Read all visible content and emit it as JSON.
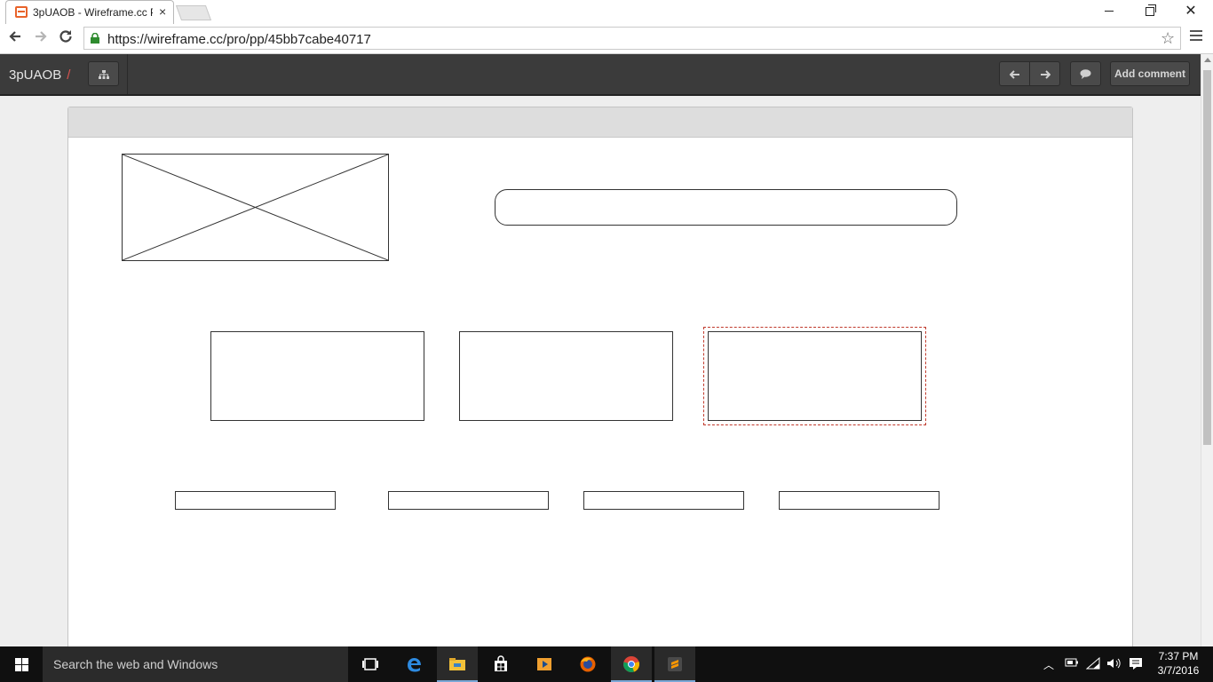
{
  "browser": {
    "tab_title": "3pUAOB - Wireframe.cc P",
    "tab_close": "×",
    "url": "https://wireframe.cc/pro/pp/45bb7cabe40717",
    "win_close": "✕"
  },
  "app_header": {
    "project_name": "3pUAOB",
    "project_separator": "/",
    "add_comment_label": "Add comment"
  },
  "taskbar": {
    "search_placeholder": "Search the web and Windows",
    "time": "7:37 PM",
    "date": "3/7/2016"
  },
  "icons": {
    "accent": "#7aa7d6",
    "selection_color": "#c0392b"
  }
}
